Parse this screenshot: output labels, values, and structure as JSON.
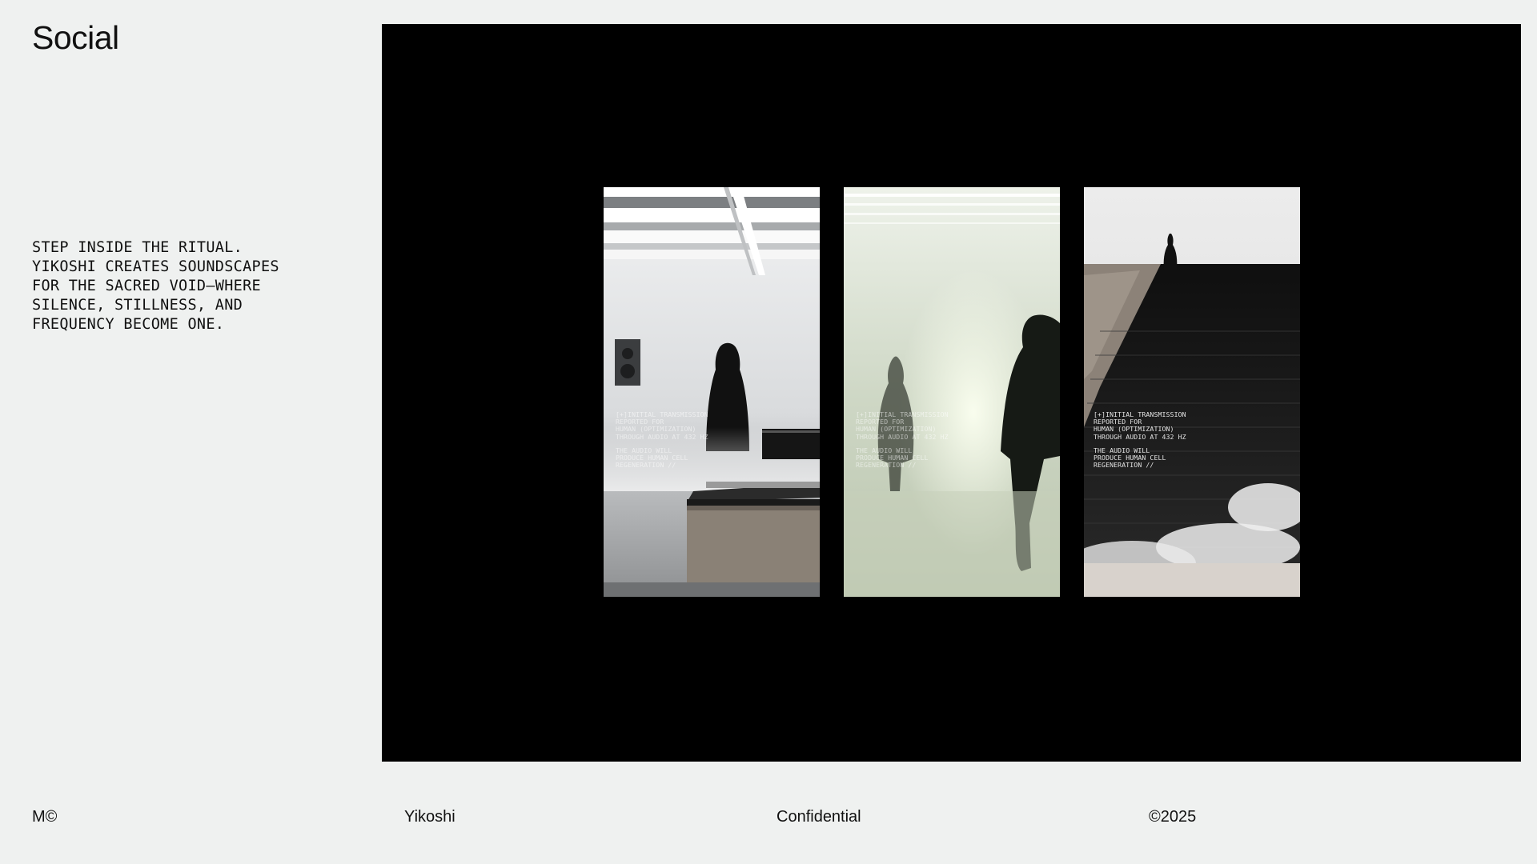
{
  "page": {
    "title": "Social",
    "tagline_lines": [
      "STEP INSIDE THE RITUAL.",
      "YIKOSHI CREATES SOUNDSCAPES",
      "FOR THE SACRED VOID—WHERE",
      "SILENCE, STILLNESS, AND",
      "FREQUENCY BECOME ONE."
    ]
  },
  "panels": [
    {
      "scene": "studio-mixing-console",
      "overlay_lines_a": [
        "[+]INITIAL TRANSMISSION",
        "REPORTED FOR",
        "HUMAN (OPTIMIZATION)",
        "THROUGH AUDIO AT 432 HZ"
      ],
      "overlay_lines_b": [
        "THE AUDIO WILL",
        "PRODUCE HUMAN CELL",
        "REGENERATION //"
      ]
    },
    {
      "scene": "misty-corridor-figures",
      "overlay_lines_a": [
        "[+]INITIAL TRANSMISSION",
        "REPORTED FOR",
        "HUMAN (OPTIMIZATION)",
        "THROUGH AUDIO AT 432 HZ"
      ],
      "overlay_lines_b": [
        "THE AUDIO WILL",
        "PRODUCE HUMAN CELL",
        "REGENERATION //"
      ]
    },
    {
      "scene": "dark-staircase-figure",
      "overlay_lines_a": [
        "[+]INITIAL TRANSMISSION",
        "REPORTED FOR",
        "HUMAN (OPTIMIZATION)",
        "THROUGH AUDIO AT 432 HZ"
      ],
      "overlay_lines_b": [
        "THE AUDIO WILL",
        "PRODUCE HUMAN CELL",
        "REGENERATION //"
      ]
    }
  ],
  "footer": {
    "mark": "M©",
    "brand": "Yikoshi",
    "label": "Confidential",
    "copyright": "©2025"
  },
  "colors": {
    "background": "#eff1f0",
    "stage": "#000000",
    "text": "#111111"
  }
}
